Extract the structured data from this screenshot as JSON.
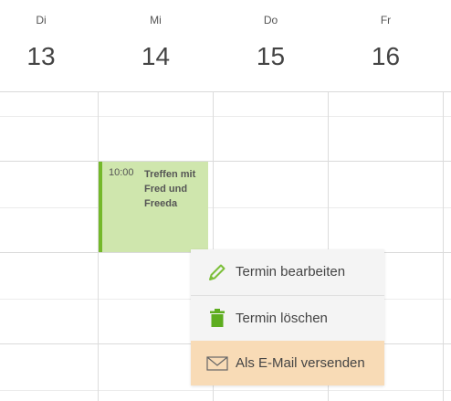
{
  "days": [
    {
      "name": "Di",
      "number": "13"
    },
    {
      "name": "Mi",
      "number": "14"
    },
    {
      "name": "Do",
      "number": "15"
    },
    {
      "name": "Fr",
      "number": "16"
    }
  ],
  "event": {
    "time": "10:00",
    "title": "Treffen mit Fred und Freeda",
    "color": "#cfe6ad",
    "accent": "#74b82a"
  },
  "context_menu": {
    "items": [
      {
        "label": "Termin bearbeiten",
        "icon": "pencil-icon"
      },
      {
        "label": "Termin löschen",
        "icon": "trash-icon"
      },
      {
        "label": "Als E-Mail versenden",
        "icon": "envelope-icon",
        "highlighted": true
      }
    ]
  }
}
